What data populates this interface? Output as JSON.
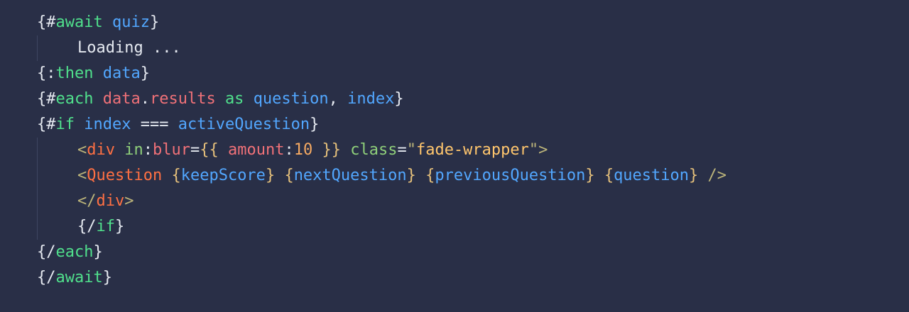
{
  "code_lines": [
    {
      "indent": false,
      "tokens": [
        {
          "t": "{#",
          "c": "p"
        },
        {
          "t": "await",
          "c": "kw"
        },
        {
          "t": " ",
          "c": "p"
        },
        {
          "t": "quiz",
          "c": "vr"
        },
        {
          "t": "}",
          "c": "p"
        }
      ]
    },
    {
      "indent": true,
      "tokens": [
        {
          "t": "Loading ...",
          "c": "p"
        }
      ]
    },
    {
      "indent": false,
      "tokens": [
        {
          "t": "{:",
          "c": "p"
        },
        {
          "t": "then",
          "c": "kw"
        },
        {
          "t": " ",
          "c": "p"
        },
        {
          "t": "data",
          "c": "vr"
        },
        {
          "t": "}",
          "c": "p"
        }
      ]
    },
    {
      "indent": false,
      "tokens": [
        {
          "t": "{#",
          "c": "p"
        },
        {
          "t": "each",
          "c": "kw"
        },
        {
          "t": " ",
          "c": "p"
        },
        {
          "t": "data",
          "c": "pr"
        },
        {
          "t": ".",
          "c": "p"
        },
        {
          "t": "results",
          "c": "pr"
        },
        {
          "t": " ",
          "c": "p"
        },
        {
          "t": "as",
          "c": "kw"
        },
        {
          "t": " ",
          "c": "p"
        },
        {
          "t": "question",
          "c": "vr"
        },
        {
          "t": ", ",
          "c": "p"
        },
        {
          "t": "index",
          "c": "vr"
        },
        {
          "t": "}",
          "c": "p"
        }
      ]
    },
    {
      "indent": false,
      "tokens": [
        {
          "t": "{#",
          "c": "p"
        },
        {
          "t": "if",
          "c": "kw"
        },
        {
          "t": " ",
          "c": "p"
        },
        {
          "t": "index",
          "c": "vr"
        },
        {
          "t": " === ",
          "c": "p"
        },
        {
          "t": "activeQuestion",
          "c": "vr"
        },
        {
          "t": "}",
          "c": "p"
        }
      ]
    },
    {
      "indent": true,
      "tokens": [
        {
          "t": "<",
          "c": "tb"
        },
        {
          "t": "div",
          "c": "tg"
        },
        {
          "t": " ",
          "c": "p"
        },
        {
          "t": "in",
          "c": "at"
        },
        {
          "t": ":",
          "c": "p"
        },
        {
          "t": "blur",
          "c": "pr"
        },
        {
          "t": "=",
          "c": "p"
        },
        {
          "t": "{{",
          "c": "ob"
        },
        {
          "t": " ",
          "c": "p"
        },
        {
          "t": "amount",
          "c": "pr"
        },
        {
          "t": ":",
          "c": "p"
        },
        {
          "t": "10",
          "c": "nm"
        },
        {
          "t": " ",
          "c": "p"
        },
        {
          "t": "}}",
          "c": "ob"
        },
        {
          "t": " ",
          "c": "p"
        },
        {
          "t": "class",
          "c": "at"
        },
        {
          "t": "=",
          "c": "p"
        },
        {
          "t": "\"",
          "c": "tb"
        },
        {
          "t": "fade-wrapper",
          "c": "st"
        },
        {
          "t": "\"",
          "c": "tb"
        },
        {
          "t": ">",
          "c": "tb"
        }
      ]
    },
    {
      "indent": true,
      "tokens": [
        {
          "t": "<",
          "c": "tb"
        },
        {
          "t": "Question",
          "c": "tg"
        },
        {
          "t": " ",
          "c": "p"
        },
        {
          "t": "{",
          "c": "ob"
        },
        {
          "t": "keepScore",
          "c": "vr"
        },
        {
          "t": "}",
          "c": "ob"
        },
        {
          "t": " ",
          "c": "p"
        },
        {
          "t": "{",
          "c": "ob"
        },
        {
          "t": "nextQuestion",
          "c": "vr"
        },
        {
          "t": "}",
          "c": "ob"
        },
        {
          "t": " ",
          "c": "p"
        },
        {
          "t": "{",
          "c": "ob"
        },
        {
          "t": "previousQuestion",
          "c": "vr"
        },
        {
          "t": "}",
          "c": "ob"
        },
        {
          "t": " ",
          "c": "p"
        },
        {
          "t": "{",
          "c": "ob"
        },
        {
          "t": "question",
          "c": "vr"
        },
        {
          "t": "}",
          "c": "ob"
        },
        {
          "t": " ",
          "c": "p"
        },
        {
          "t": "/>",
          "c": "tb"
        }
      ]
    },
    {
      "indent": true,
      "tokens": [
        {
          "t": "</",
          "c": "tb"
        },
        {
          "t": "div",
          "c": "tg"
        },
        {
          "t": ">",
          "c": "tb"
        }
      ]
    },
    {
      "indent": true,
      "tokens": [
        {
          "t": "{/",
          "c": "p"
        },
        {
          "t": "if",
          "c": "kw"
        },
        {
          "t": "}",
          "c": "p"
        }
      ]
    },
    {
      "indent": false,
      "tokens": [
        {
          "t": "{/",
          "c": "p"
        },
        {
          "t": "each",
          "c": "kw"
        },
        {
          "t": "}",
          "c": "p"
        }
      ]
    },
    {
      "indent": false,
      "tokens": [
        {
          "t": "{/",
          "c": "p"
        },
        {
          "t": "await",
          "c": "kw"
        },
        {
          "t": "}",
          "c": "p"
        }
      ]
    }
  ]
}
